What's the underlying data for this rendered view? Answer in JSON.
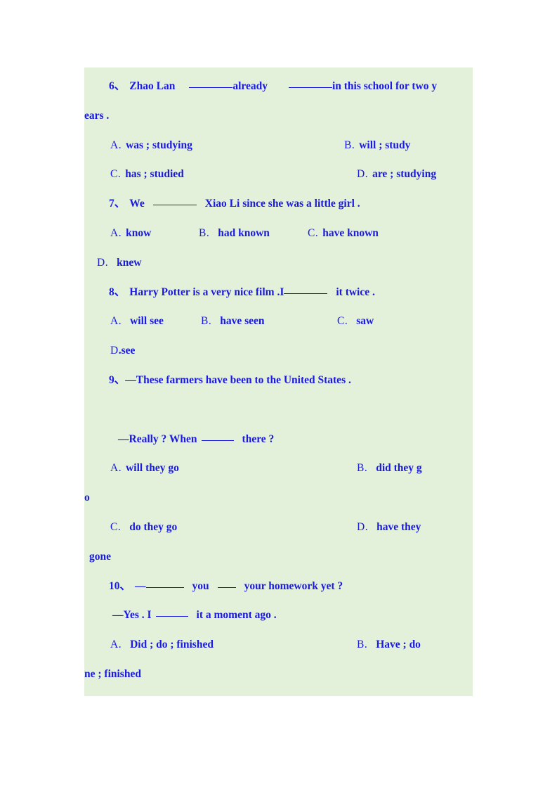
{
  "page": {
    "background_color": "#ffffff",
    "block_color": "#e3f0da",
    "text_color": "#1a1ae0"
  },
  "questions": [
    {
      "number": "6、",
      "stem_before_blank1": "Zhao Lan",
      "stem_mid": "already",
      "stem_after_blank2": "in this school for two y",
      "stem_wrap": "ears .",
      "options": {
        "a_label": "A.",
        "a_text": "was ; studying",
        "b_label": "B.",
        "b_text": "will ; study",
        "c_label": "C.",
        "c_text": "has ; studied",
        "d_label": "D.",
        "d_text": "are ; studying"
      }
    },
    {
      "number": "7、",
      "stem_before_blank": "We",
      "stem_after_blank": "Xiao Li since she was a little girl .",
      "options": {
        "a_label": "A.",
        "a_text": "know",
        "b_label": "B.",
        "b_text": "had known",
        "c_label": "C.",
        "c_text": "have known",
        "d_label": "D.",
        "d_text": "knew"
      }
    },
    {
      "number": "8、",
      "stem_before_blank": "Harry Potter is a very nice film .I",
      "stem_after_blank": "it twice .",
      "options": {
        "a_label": "A.",
        "a_text": "will see",
        "b_label": "B.",
        "b_text": "have seen",
        "c_label": "C.",
        "c_text": "saw",
        "d_label": "D",
        "d_text": ".see"
      }
    },
    {
      "number": "9、",
      "stem_line1": "—These farmers have been to the United States .",
      "stem_line2_before_blank": "—Really ? When",
      "stem_line2_after_blank": "there ?",
      "options": {
        "a_label": "A.",
        "a_text": "will they go",
        "b_label": "B.",
        "b_text": "did they g",
        "b_wrap": "o",
        "c_label": "C.",
        "c_text": "do they go",
        "d_label": "D.",
        "d_text": "have they",
        "d_wrap": "gone"
      }
    },
    {
      "number": "10、",
      "stem_line1_prefix": "—",
      "stem_line1_mid": "you",
      "stem_line1_after": "your homework yet ?",
      "stem_line2_before_blank": "—Yes . I",
      "stem_line2_after_blank": "it a moment ago .",
      "options": {
        "a_label": "A.",
        "a_text": "Did ; do ; finished",
        "b_label": "B.",
        "b_text": "Have ; do",
        "b_wrap": "ne ; finished"
      }
    }
  ]
}
